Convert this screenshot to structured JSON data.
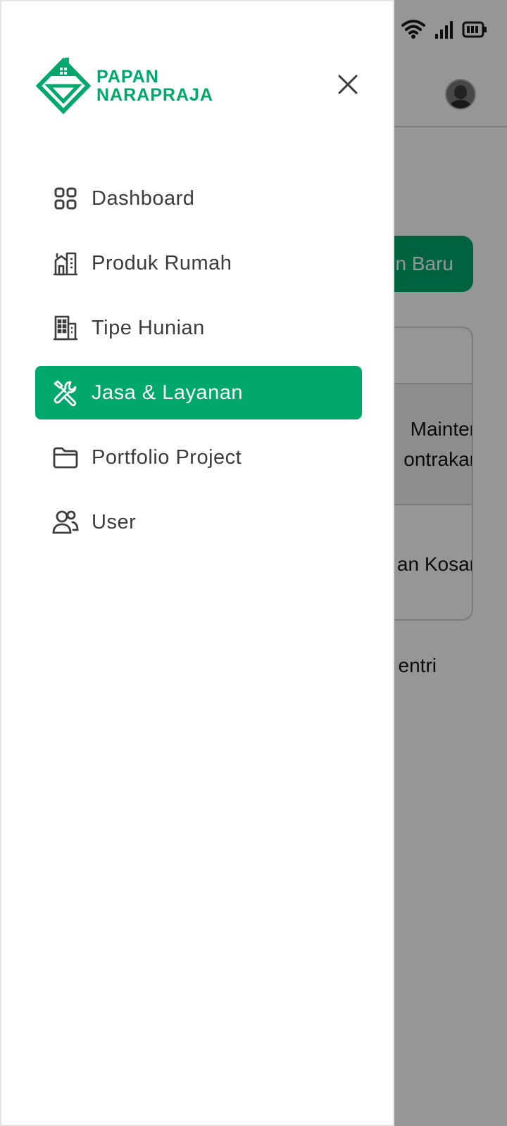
{
  "brand": {
    "line1": "PAPAN",
    "line2": "NARAPRAJA",
    "color": "#00a86b"
  },
  "menu": {
    "items": [
      {
        "label": "Dashboard",
        "icon": "grid-icon",
        "active": false
      },
      {
        "label": "Produk Rumah",
        "icon": "house-building-icon",
        "active": false
      },
      {
        "label": "Tipe Hunian",
        "icon": "building-icon",
        "active": false
      },
      {
        "label": "Jasa & Layanan",
        "icon": "tools-icon",
        "active": true
      },
      {
        "label": "Portfolio Project",
        "icon": "folder-icon",
        "active": false
      },
      {
        "label": "User",
        "icon": "users-icon",
        "active": false
      }
    ]
  },
  "background": {
    "add_button_label": "n Baru",
    "rows": [
      {
        "line1": "Mainter",
        "line2": "ontrakar"
      },
      {
        "line1": "an Kosar"
      }
    ],
    "footer_text": "entri"
  },
  "colors": {
    "accent": "#00a86b",
    "overlay": "rgba(0,0,0,0.41)"
  }
}
